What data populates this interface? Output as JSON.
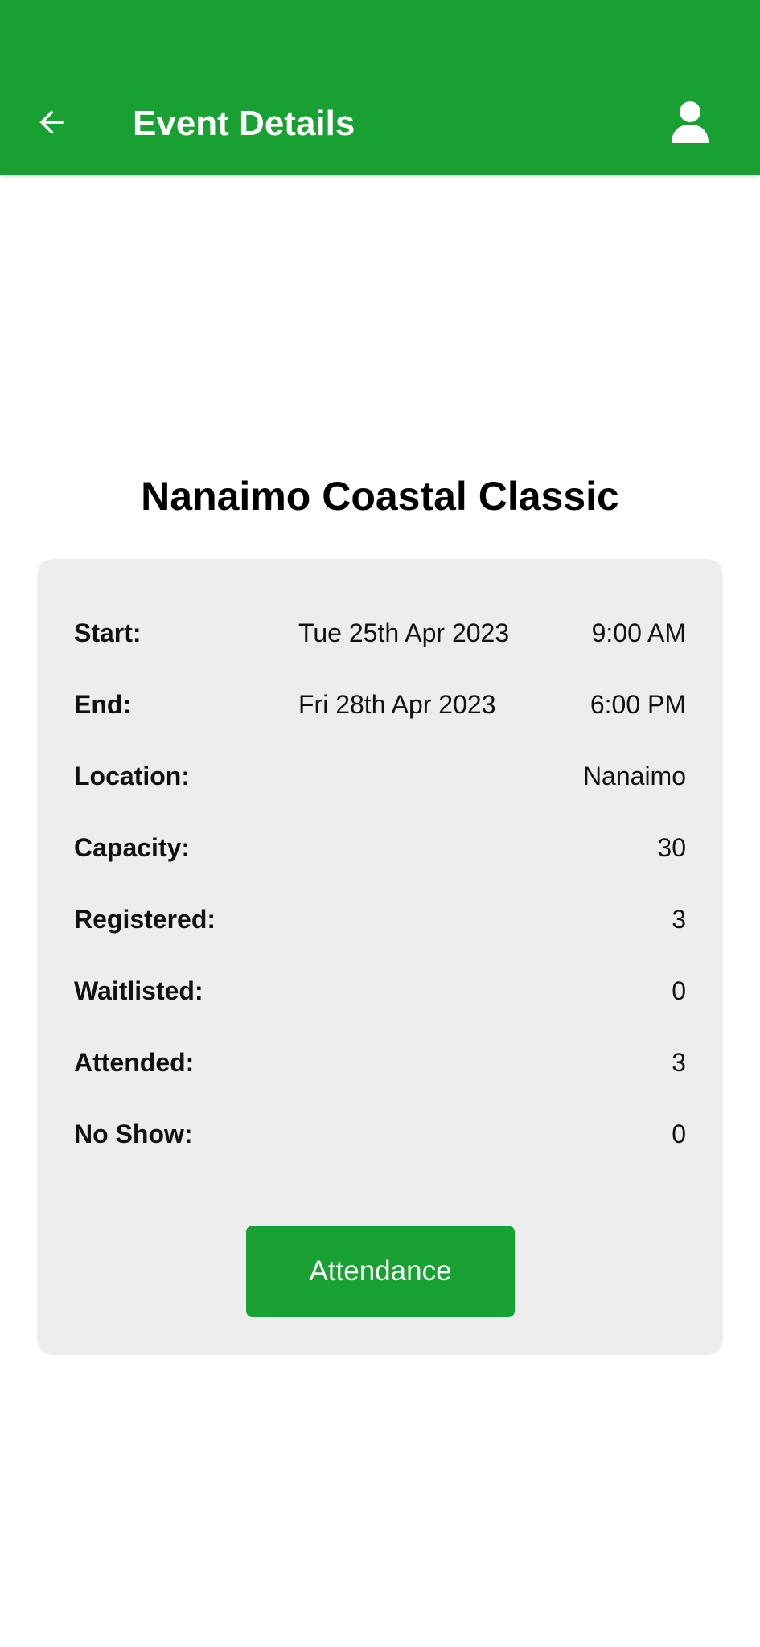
{
  "colors": {
    "primary": "#18a032",
    "card_background": "#ededed",
    "on_primary": "#ffffff"
  },
  "app_bar": {
    "title": "Event Details",
    "back_icon": "arrow-left-icon",
    "profile_icon": "person-icon"
  },
  "event": {
    "title": "Nanaimo Coastal Classic"
  },
  "details": {
    "start": {
      "label": "Start:",
      "date": "Tue 25th Apr 2023",
      "time": "9:00 AM"
    },
    "end": {
      "label": "End:",
      "date": "Fri 28th Apr 2023",
      "time": "6:00 PM"
    },
    "location": {
      "label": "Location:",
      "value": "Nanaimo"
    },
    "capacity": {
      "label": "Capacity:",
      "value": "30"
    },
    "registered": {
      "label": "Registered:",
      "value": "3"
    },
    "waitlisted": {
      "label": "Waitlisted:",
      "value": "0"
    },
    "attended": {
      "label": "Attended:",
      "value": "3"
    },
    "no_show": {
      "label": "No Show:",
      "value": "0"
    }
  },
  "actions": {
    "attendance_label": "Attendance"
  }
}
